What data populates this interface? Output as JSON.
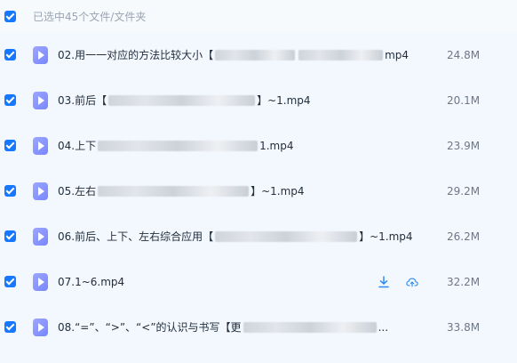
{
  "header": {
    "text": "已选中45个文件/文件夹"
  },
  "files": [
    {
      "prefix": "02.用一一对应的方法比较大小【",
      "suffix": "mp4",
      "size": "24.8M"
    },
    {
      "prefix": "03.前后【",
      "suffix": "】~1.mp4",
      "size": "20.1M"
    },
    {
      "prefix": "04.上下",
      "suffix": "1.mp4",
      "size": "23.9M"
    },
    {
      "prefix": "05.左右",
      "suffix": "】~1.mp4",
      "size": "29.2M"
    },
    {
      "prefix": "06.前后、上下、左右综合应用【",
      "suffix": "】~1.mp4",
      "size": "26.2M"
    },
    {
      "prefix": "07.1~6.mp4",
      "suffix": "",
      "size": "32.2M"
    },
    {
      "prefix": "08.“=”、“>”、“<”的认识与书写【更",
      "suffix": "...",
      "size": "33.8M"
    }
  ],
  "icons": {
    "file": "video-file-icon",
    "download": "download-icon",
    "cloud_upload": "cloud-upload-icon"
  }
}
